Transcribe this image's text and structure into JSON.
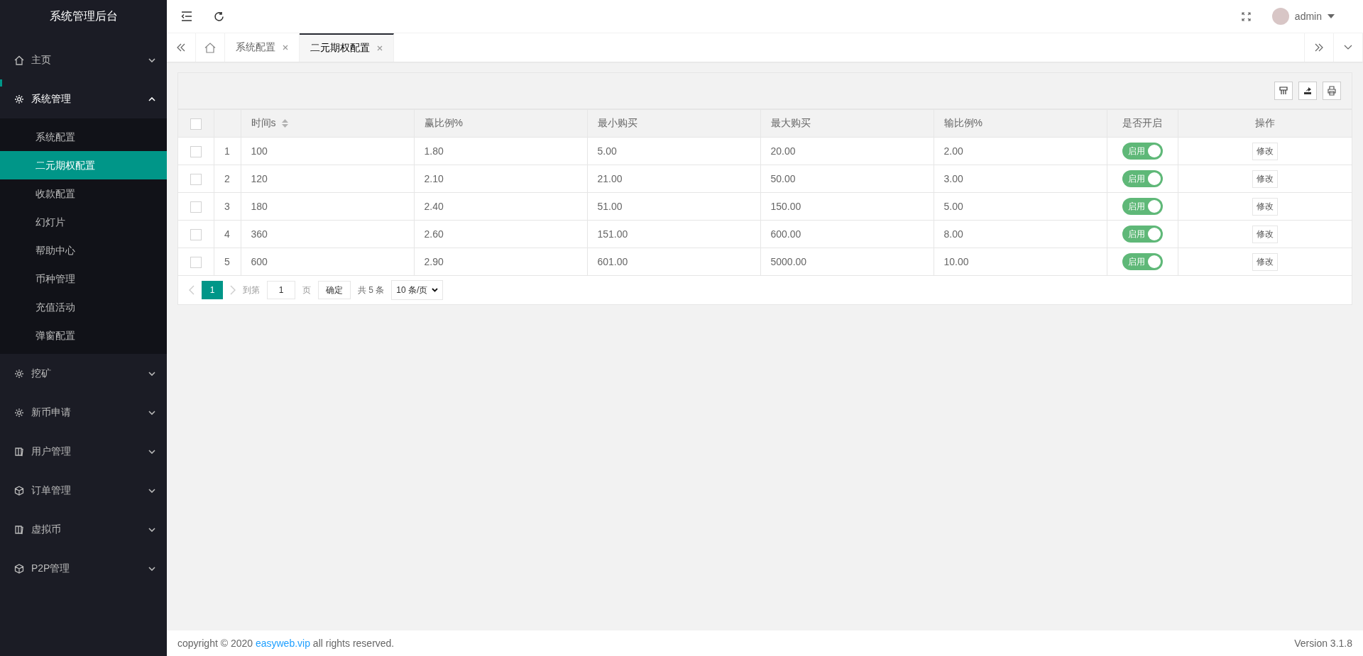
{
  "sidebar": {
    "title": "系统管理后台",
    "items": [
      {
        "label": "主页",
        "kind": "home",
        "expanded": false
      },
      {
        "label": "系统管理",
        "kind": "gear",
        "expanded": true,
        "children": [
          {
            "label": "系统配置",
            "selected": false
          },
          {
            "label": "二元期权配置",
            "selected": true
          },
          {
            "label": "收款配置",
            "selected": false
          },
          {
            "label": "幻灯片",
            "selected": false
          },
          {
            "label": "帮助中心",
            "selected": false
          },
          {
            "label": "币种管理",
            "selected": false
          },
          {
            "label": "充值活动",
            "selected": false
          },
          {
            "label": "弹窗配置",
            "selected": false
          }
        ]
      },
      {
        "label": "挖矿",
        "kind": "gear",
        "expanded": false
      },
      {
        "label": "新币申请",
        "kind": "gear",
        "expanded": false
      },
      {
        "label": "用户管理",
        "kind": "book",
        "expanded": false
      },
      {
        "label": "订单管理",
        "kind": "cube",
        "expanded": false
      },
      {
        "label": "虚拟币",
        "kind": "book",
        "expanded": false
      },
      {
        "label": "P2P管理",
        "kind": "cube",
        "expanded": false
      }
    ]
  },
  "header": {
    "user": "admin"
  },
  "tabs": [
    {
      "label": "系统配置",
      "selected": false
    },
    {
      "label": "二元期权配置",
      "selected": true
    }
  ],
  "table": {
    "all_checked": false,
    "columns": [
      "时间s",
      "赢比例%",
      "最小购买",
      "最大购买",
      "输比例%",
      "是否开启",
      "操作"
    ],
    "rows": [
      {
        "checked": false,
        "index": "1",
        "cells": [
          "100",
          "1.80",
          "5.00",
          "20.00",
          "2.00"
        ],
        "enabled": true,
        "switch_label": "启用",
        "action": "修改"
      },
      {
        "checked": false,
        "index": "2",
        "cells": [
          "120",
          "2.10",
          "21.00",
          "50.00",
          "3.00"
        ],
        "enabled": true,
        "switch_label": "启用",
        "action": "修改"
      },
      {
        "checked": false,
        "index": "3",
        "cells": [
          "180",
          "2.40",
          "51.00",
          "150.00",
          "5.00"
        ],
        "enabled": true,
        "switch_label": "启用",
        "action": "修改"
      },
      {
        "checked": false,
        "index": "4",
        "cells": [
          "360",
          "2.60",
          "151.00",
          "600.00",
          "8.00"
        ],
        "enabled": true,
        "switch_label": "启用",
        "action": "修改"
      },
      {
        "checked": false,
        "index": "5",
        "cells": [
          "600",
          "2.90",
          "601.00",
          "5000.00",
          "10.00"
        ],
        "enabled": true,
        "switch_label": "启用",
        "action": "修改"
      }
    ]
  },
  "pagination": {
    "pages": [
      {
        "label": "1",
        "selected": true
      }
    ],
    "goto_label": "到第",
    "goto_value": "1",
    "page_unit": "页",
    "confirm": "确定",
    "total": "共 5 条",
    "page_size": "10 条/页"
  },
  "footer": {
    "copyright": "copyright © 2020 ",
    "link": "easyweb.vip",
    "rest": " all rights reserved.",
    "version": "Version 3.1.8"
  }
}
